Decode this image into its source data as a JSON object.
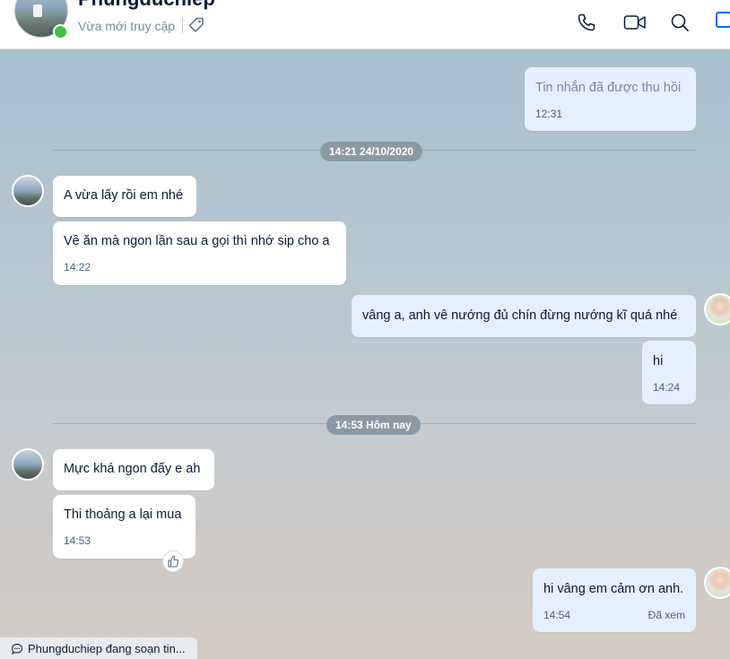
{
  "header": {
    "contact_name": "Phungduchiep",
    "status": "Vừa mới truy cập",
    "icons": [
      "tag-icon",
      "phone-icon",
      "video-call-icon",
      "search-icon",
      "sidebar-toggle-icon"
    ]
  },
  "colors": {
    "accent": "#0068ff",
    "online": "#43c143",
    "incoming_bubble": "#ffffff",
    "outgoing_bubble": "#e5efff"
  },
  "messages": [
    {
      "direction": "out",
      "text": "Tin nhắn đã được thu hồi",
      "time": "12:31",
      "recalled": true
    },
    {
      "divider": "14:21 24/10/2020"
    },
    {
      "direction": "in",
      "text": "A vừa lấy rồi em nhé"
    },
    {
      "direction": "in",
      "text": "Về ăn mà ngon lần sau a gọi thì nhớ sip cho a",
      "time": "14:22"
    },
    {
      "direction": "out",
      "text": "vâng a, anh  vê nướng đủ chín đừng nướng kĩ quá nhé"
    },
    {
      "direction": "out",
      "text": "hi",
      "time": "14:24"
    },
    {
      "divider": "14:53 Hôm nay"
    },
    {
      "direction": "in",
      "text": "Mực khá ngon đấy e ah"
    },
    {
      "direction": "in",
      "text": "Thi thoảng a lại mua",
      "time": "14:53"
    },
    {
      "direction": "out",
      "text": "hi vâng em cảm ơn anh.",
      "time": "14:54",
      "receipt": "Đã xem"
    }
  ],
  "typing_indicator": "Phungduchiep đang soạn tin..."
}
